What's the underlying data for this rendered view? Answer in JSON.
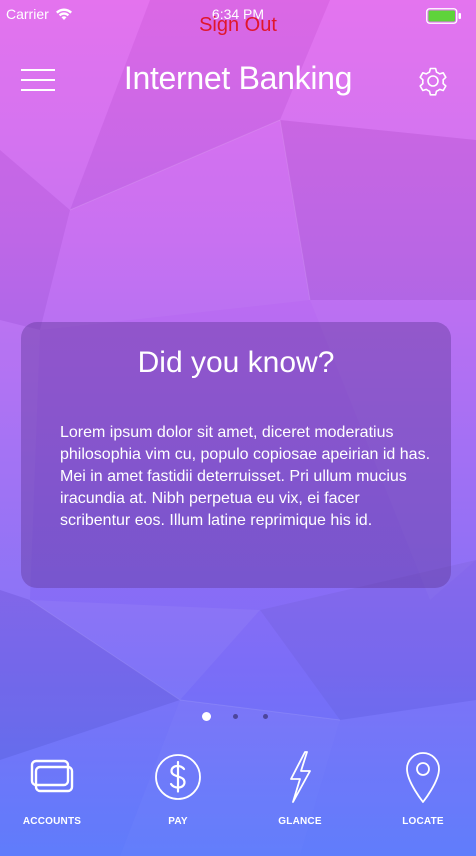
{
  "status_bar": {
    "carrier": "Carrier",
    "time": "6:34 PM",
    "wifi_icon": "wifi-icon",
    "battery_icon": "battery-icon",
    "battery_color": "#5fd33b"
  },
  "header": {
    "sign_out": "Sign Out",
    "sign_out_color": "#e0162b",
    "title": "Internet Banking",
    "menu_icon": "hamburger-menu-icon",
    "settings_icon": "gear-icon"
  },
  "card": {
    "title": "Did you know?",
    "body": "Lorem ipsum dolor sit amet, diceret moderatius philosophia vim cu, populo copiosae apeirian id has. Mei in amet fastidii deterruisset. Pri ullum mucius iracundia at. Nibh perpetua eu vix, ei facer scribentur eos. Illum latine reprimique his id."
  },
  "pager": {
    "pages": 3,
    "current": 1
  },
  "tabs": [
    {
      "label": "ACCOUNTS",
      "icon": "cards-icon"
    },
    {
      "label": "PAY",
      "icon": "dollar-icon"
    },
    {
      "label": "GLANCE",
      "icon": "lightning-icon"
    },
    {
      "label": "LOCATE",
      "icon": "map-pin-icon"
    }
  ],
  "colors": {
    "gradient_top": "#e36cee",
    "gradient_bottom": "#5a78fb",
    "text": "#ffffff"
  }
}
